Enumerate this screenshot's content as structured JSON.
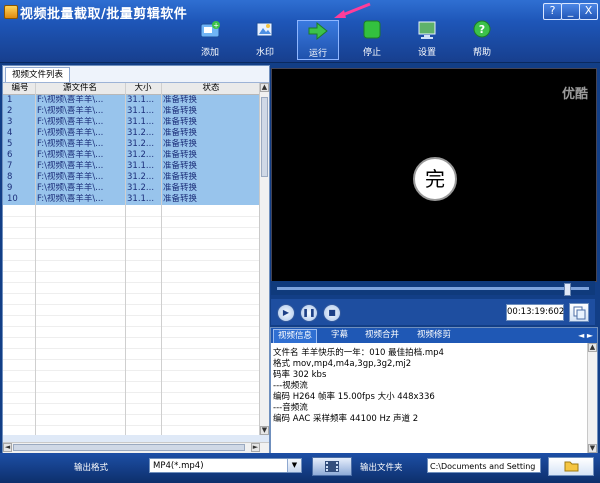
{
  "window": {
    "title": "视频批量截取/批量剪辑软件",
    "controls": [
      "?",
      "_",
      "X"
    ]
  },
  "toolbar": [
    {
      "label": "添加",
      "icon": "add-video-icon"
    },
    {
      "label": "水印",
      "icon": "watermark-icon"
    },
    {
      "label": "运行",
      "icon": "run-arrow-icon",
      "active": true
    },
    {
      "label": "停止",
      "icon": "stop-icon"
    },
    {
      "label": "设置",
      "icon": "settings-monitor-icon"
    },
    {
      "label": "帮助",
      "icon": "help-icon"
    }
  ],
  "file_list": {
    "tab": "视频文件列表",
    "columns": [
      "编号",
      "源文件名",
      "大小",
      "状态"
    ],
    "rows": [
      [
        "1",
        "F:\\视频\\喜羊羊\\...",
        "31.1...",
        "准备转换"
      ],
      [
        "2",
        "F:\\视频\\喜羊羊\\...",
        "31.1...",
        "准备转换"
      ],
      [
        "3",
        "F:\\视频\\喜羊羊\\...",
        "31.1...",
        "准备转换"
      ],
      [
        "4",
        "F:\\视频\\喜羊羊\\...",
        "31.2...",
        "准备转换"
      ],
      [
        "5",
        "F:\\视频\\喜羊羊\\...",
        "31.2...",
        "准备转换"
      ],
      [
        "6",
        "F:\\视频\\喜羊羊\\...",
        "31.2...",
        "准备转换"
      ],
      [
        "7",
        "F:\\视频\\喜羊羊\\...",
        "31.1...",
        "准备转换"
      ],
      [
        "8",
        "F:\\视频\\喜羊羊\\...",
        "31.2...",
        "准备转换"
      ],
      [
        "9",
        "F:\\视频\\喜羊羊\\...",
        "31.2...",
        "准备转换"
      ],
      [
        "10",
        "F:\\视频\\喜羊羊\\...",
        "31.1...",
        "准备转换"
      ]
    ]
  },
  "player": {
    "logo": "优酷",
    "overlay_text": "完",
    "seek_fraction": 0.93,
    "time": "00:13:19:602"
  },
  "info": {
    "tabs": [
      "视频信息",
      "字幕",
      "视频合并",
      "视频修剪"
    ],
    "lines": [
      "文件名  羊羊快乐的一年：010 最佳拍档.mp4",
      "格式  mov,mp4,m4a,3gp,3g2,mj2",
      "码率  302 kbs",
      "---视频流",
      "编码  H264   帧率  15.00fps   大小  448x336",
      "---音频流",
      "编码  AAC   采样频率  44100 Hz   声道  2"
    ]
  },
  "bottom": {
    "format_label": "输出格式",
    "format_value": "MP4(*.mp4)",
    "folder_label": "输出文件夹",
    "folder_value": "C:\\Documents and Setting"
  }
}
